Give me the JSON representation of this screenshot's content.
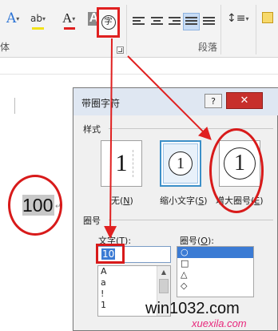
{
  "ribbon": {
    "font_group_label": "体",
    "paragraph_group_label": "段落",
    "enclose_button_glyph": "字",
    "text_effects_glyph": "A",
    "font_color_glyph": "A",
    "char_shading_glyph": "A",
    "highlight_glyph": "ab",
    "caret": "▾",
    "colors": {
      "red_bar": "#e02020",
      "yellow_bar": "#f2e21a",
      "accent_blue": "#2e75d6"
    }
  },
  "document": {
    "selected_text": "100",
    "paragraph_mark": "↵"
  },
  "dialog": {
    "title": "带圈字符",
    "help_glyph": "?",
    "close_glyph": "✕",
    "style_section": "样式",
    "styles": [
      {
        "glyph": "1",
        "label": "无",
        "key": "N"
      },
      {
        "glyph": "1",
        "label": "缩小文字",
        "key": "S"
      },
      {
        "glyph": "1",
        "label": "增大圈号",
        "key": "E"
      }
    ],
    "enclosure_section": "圈号",
    "text_label": "文字",
    "text_key": "T",
    "text_value": "10",
    "text_options": [
      "A",
      "a",
      "!",
      "1"
    ],
    "enclosure_label": "圈号",
    "enclosure_key": "O",
    "enclosure_options": [
      "○",
      "□",
      "△",
      "◇"
    ]
  },
  "watermark": {
    "main": "win1032.com",
    "sub": "xuexila.com"
  }
}
